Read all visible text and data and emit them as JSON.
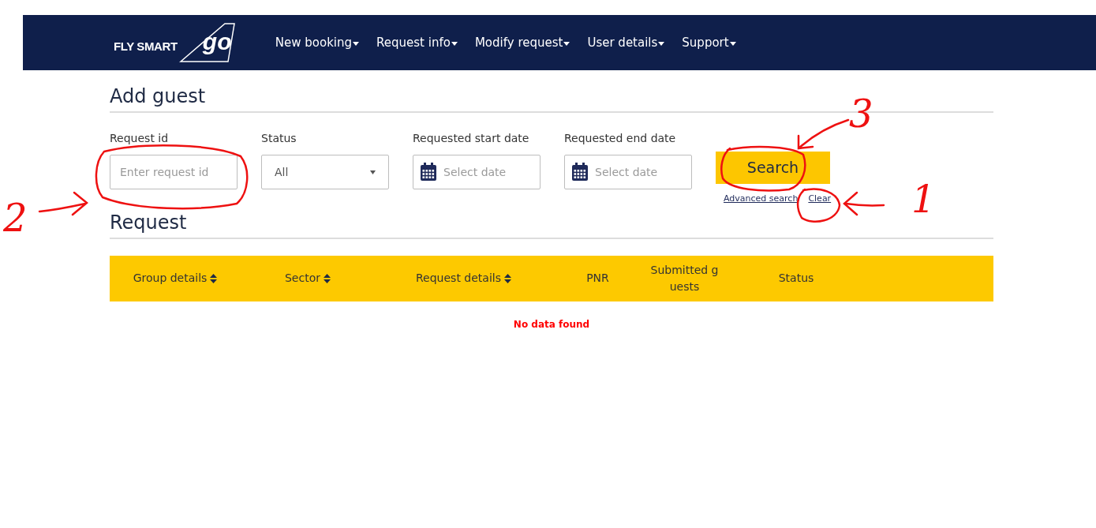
{
  "brand": {
    "tagline": "FLY SMART",
    "mark": "go"
  },
  "nav": [
    {
      "label": "New booking"
    },
    {
      "label": "Request info"
    },
    {
      "label": "Modify request"
    },
    {
      "label": "User details"
    },
    {
      "label": "Support"
    }
  ],
  "title": "Add guest",
  "filters": [
    {
      "kind": "text",
      "label": "Request id",
      "placeholder": "Enter request id"
    },
    {
      "kind": "select",
      "label": "Status",
      "value": "All"
    },
    {
      "kind": "date",
      "label": "Requested start date",
      "placeholder": "Select date"
    },
    {
      "kind": "date",
      "label": "Requested end date",
      "placeholder": "Select date"
    }
  ],
  "search_button": "Search",
  "links": [
    "Advanced search",
    "Clear"
  ],
  "section": "Request",
  "table": {
    "columns": [
      {
        "label": "Group details",
        "sortable": true
      },
      {
        "label": "Sector",
        "sortable": true
      },
      {
        "label": "Request details",
        "sortable": true
      },
      {
        "label": "PNR",
        "sortable": false
      },
      {
        "label": "Submitted g uests",
        "sortable": false
      },
      {
        "label": "Status",
        "sortable": false
      }
    ],
    "empty": "No data found"
  },
  "annotations": [
    {
      "label": "1"
    },
    {
      "label": "2"
    },
    {
      "label": "3"
    }
  ]
}
